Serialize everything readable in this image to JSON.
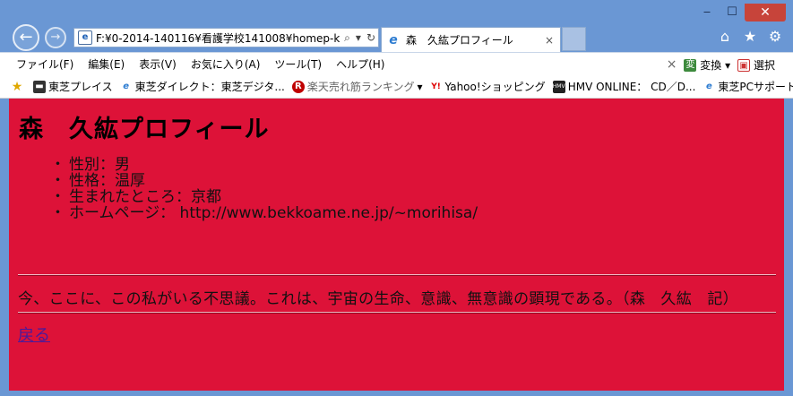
{
  "window": {
    "minimize": "‒",
    "maximize": "☐",
    "close": "✕"
  },
  "nav": {
    "back_glyph": "←",
    "forward_glyph": "→"
  },
  "address_bar": {
    "url": "F:¥0-2014-140116¥看護学校141008¥homep-k",
    "search_glyph": "⌕",
    "dropdown_glyph": "▾",
    "refresh_glyph": "↻"
  },
  "tab": {
    "title": "森　久紘プロフィール",
    "close_glyph": "×"
  },
  "right_tools": {
    "home_glyph": "⌂",
    "favorites_glyph": "★",
    "settings_glyph": "⚙"
  },
  "menu": {
    "items": [
      "ファイル(F)",
      "編集(E)",
      "表示(V)",
      "お気に入り(A)",
      "ツール(T)",
      "ヘルプ(H)"
    ],
    "close_glyph": "×",
    "convert_label": "変換",
    "select_label": "選択"
  },
  "favorites": [
    {
      "label": "東芝プレイス",
      "icon": "page-icon"
    },
    {
      "label": "東芝ダイレクト：東芝デジタ...",
      "icon": "ie-icon"
    },
    {
      "label": "楽天売れ筋ランキング",
      "icon": "rakuten-icon"
    },
    {
      "label": "Yahoo!ショッピング",
      "icon": "yahoo-icon"
    },
    {
      "label": "HMV ONLINE： CD／D...",
      "icon": "hmv-icon"
    },
    {
      "label": "東芝PCサポート情報",
      "icon": "ie-icon"
    }
  ],
  "page": {
    "heading": "森　久紘プロフィール",
    "profile": [
      "性別：男",
      "性格：温厚",
      "生まれたところ：京都",
      "ホームページ： http://www.bekkoame.ne.jp/~morihisa/"
    ],
    "quote": "今、ここに、この私がいる不思議。これは、宇宙の生命、意識、無意識の顕現である。（森　久紘　記）",
    "back_link": "戻る"
  },
  "colors": {
    "page_background": "#dd1238",
    "frame": "#6a97d4",
    "link": "#4b1a9a"
  }
}
